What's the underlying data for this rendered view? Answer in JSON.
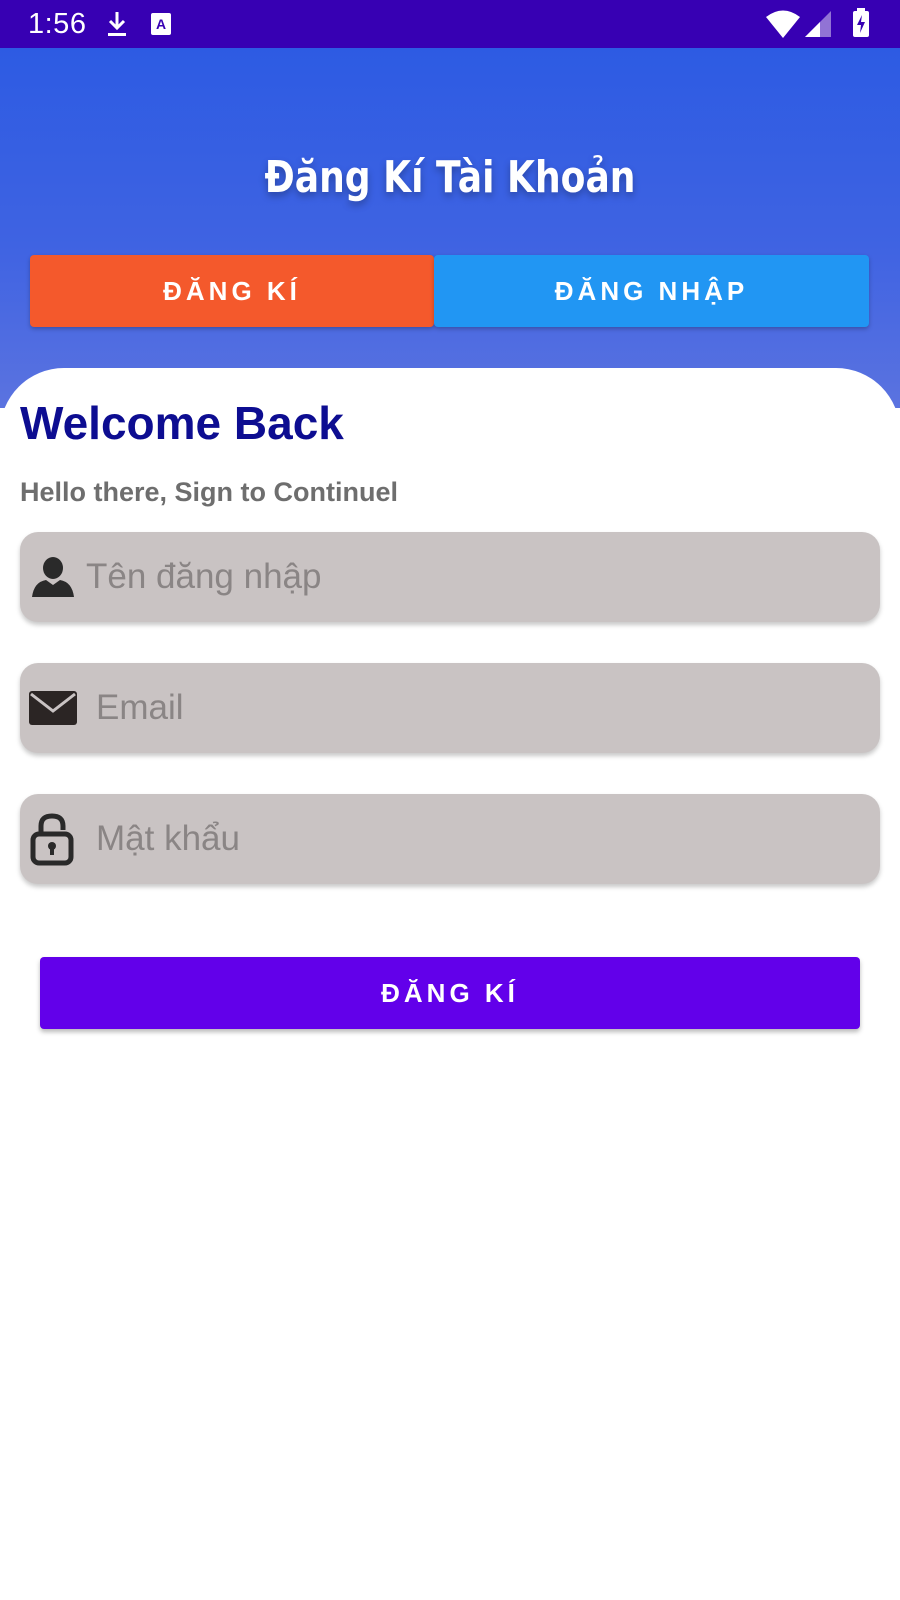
{
  "status_bar": {
    "time": "1:56",
    "left_icons": [
      "download-icon",
      "text-icon"
    ],
    "right_icons": [
      "wifi-icon",
      "signal-icon",
      "battery-icon"
    ],
    "background_color": "#3700b3"
  },
  "header": {
    "title": "Đăng Kí Tài Khoản",
    "gradient_colors": [
      "#2d5be3",
      "#5b73e0"
    ]
  },
  "tabs": [
    {
      "label": "ĐĂNG KÍ",
      "color": "#f4592c",
      "active": true
    },
    {
      "label": "ĐĂNG NHẬP",
      "color": "#2196f3",
      "active": false
    }
  ],
  "form": {
    "heading": "Welcome Back",
    "subheading": "Hello there, Sign to Continuel",
    "fields": [
      {
        "icon": "user-icon",
        "placeholder": "Tên đăng nhập",
        "value": ""
      },
      {
        "icon": "envelope-icon",
        "placeholder": "Email",
        "value": ""
      },
      {
        "icon": "lock-icon",
        "placeholder": "Mật khẩu",
        "value": ""
      }
    ],
    "submit_label": "ĐĂNG KÍ",
    "submit_color": "#6200ea",
    "heading_color": "#0d0d91"
  }
}
